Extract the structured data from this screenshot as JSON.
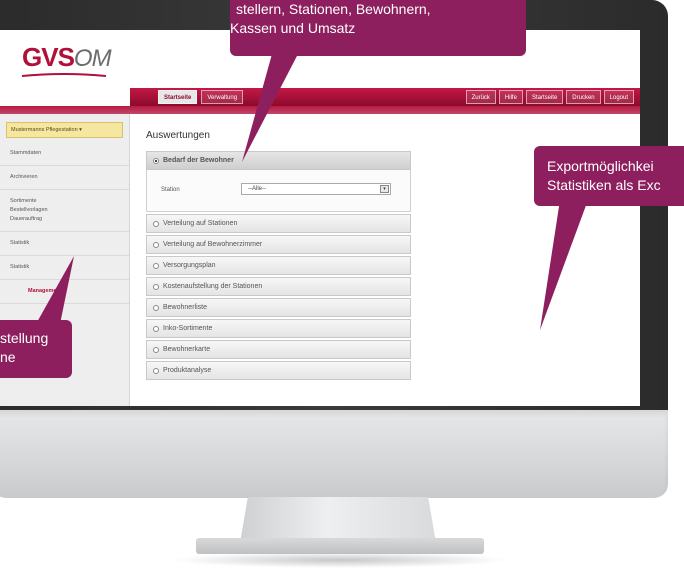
{
  "callouts": {
    "top": {
      "line1": "stellern, Stationen, Bewohnern,",
      "line2": "Kassen und Umsatz"
    },
    "right": {
      "line1": "Exportmöglichkei",
      "line2": "Statistiken als Exc"
    },
    "left": {
      "line1": "stellung",
      "line2": "ne"
    }
  },
  "app": {
    "logo_main": "GVS",
    "logo_om": "OM",
    "brand_color": "#b0103a",
    "callout_color": "#8e1f5e"
  },
  "menu": {
    "left_items": [
      "Startseite",
      "Verwaltung"
    ],
    "right_items": [
      "Zurück",
      "Hilfe",
      "Startseite",
      "Drucken",
      "Logout"
    ]
  },
  "sidebar": {
    "home": "Mustermanns Pflegestation ▾",
    "items": [
      {
        "label": "Stammdaten"
      },
      {
        "label": "Archivieren"
      },
      {
        "label": "Sortimente\nBestellvorlagen\nDauerauftrag"
      },
      {
        "label": "Statistik"
      },
      {
        "label": "Statistik"
      },
      {
        "label": "Management"
      }
    ]
  },
  "main": {
    "title": "Auswertungen",
    "accordion": [
      {
        "label": "Bedarf der Bewohner",
        "open": true
      },
      {
        "label": "Verteilung auf Stationen"
      },
      {
        "label": "Verteilung auf Bewohnerzimmer"
      },
      {
        "label": "Versorgungsplan"
      },
      {
        "label": "Kostenaufstellung der Stationen"
      },
      {
        "label": "Bewohnerliste"
      },
      {
        "label": "Inko-Sortimente"
      },
      {
        "label": "Bewohnerkarte"
      },
      {
        "label": "Produktanalyse"
      }
    ],
    "station_label": "Station",
    "station_value": "--Alle--"
  }
}
